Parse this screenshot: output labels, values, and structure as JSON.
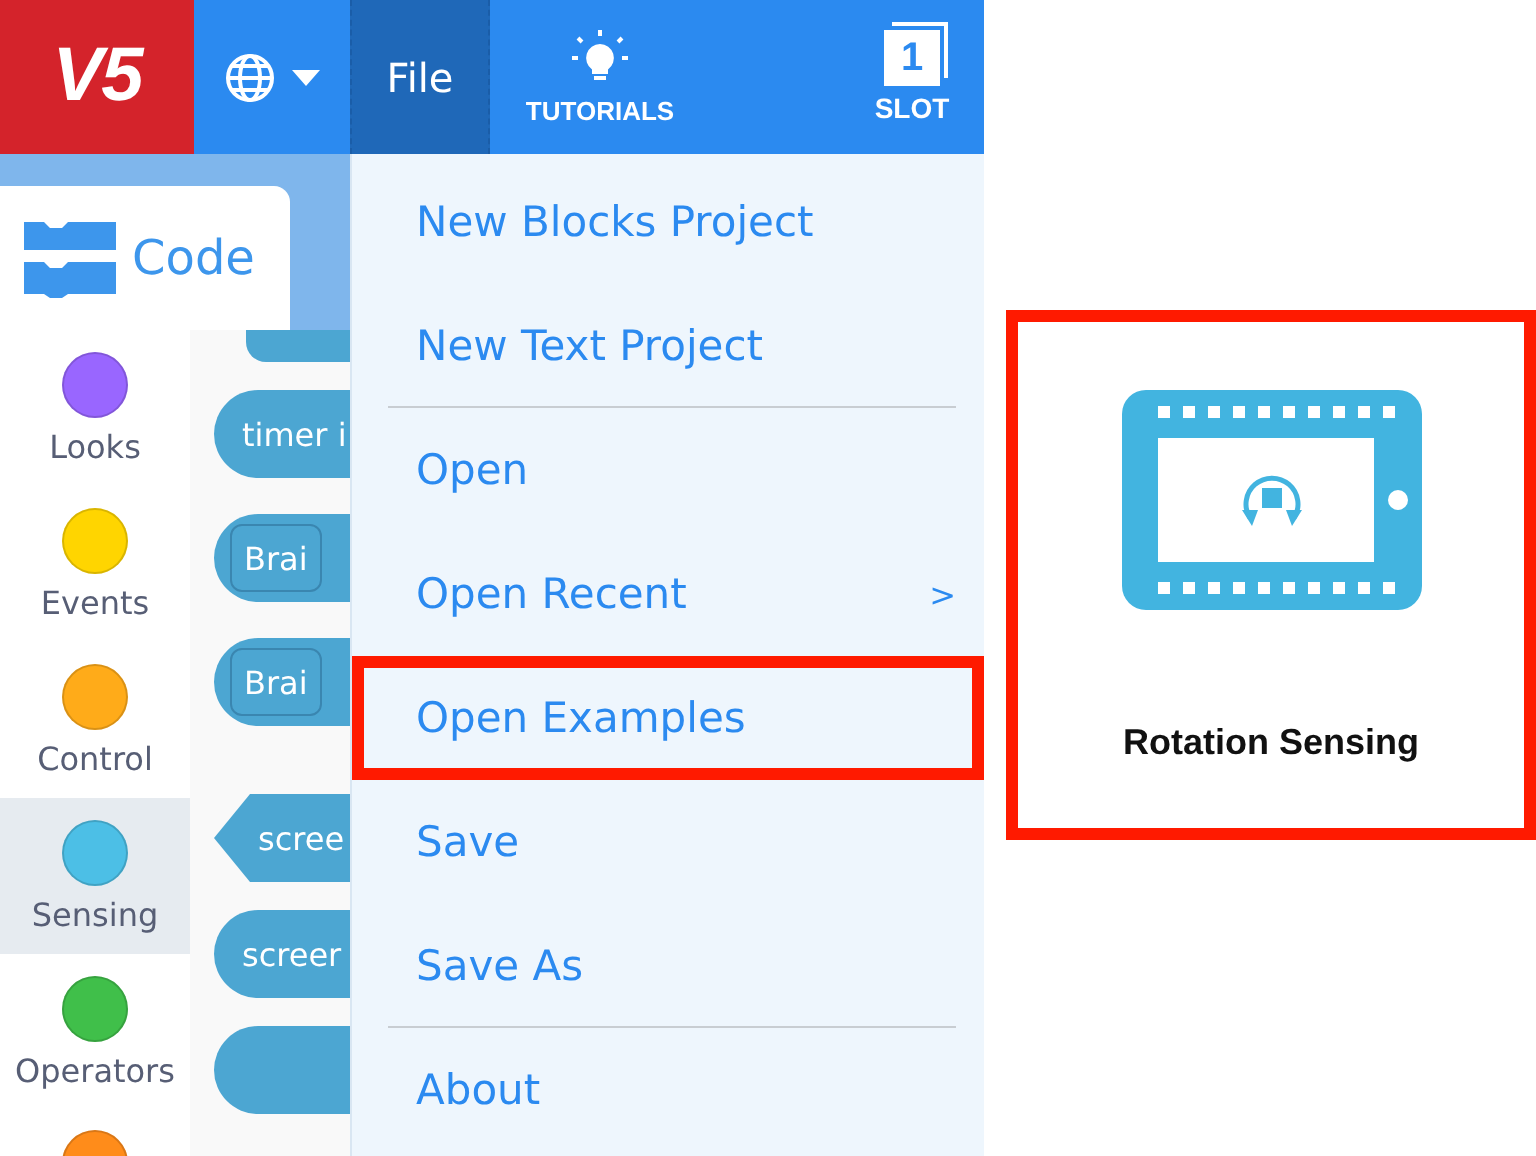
{
  "topbar": {
    "logo": "V5",
    "menus": [
      {
        "kind": "language",
        "selected": false
      },
      {
        "kind": "text",
        "label": "File",
        "selected": true
      },
      {
        "kind": "tutorials",
        "label": "TUTORIALS",
        "selected": false
      }
    ],
    "slot": {
      "number": "1",
      "label": "SLOT"
    }
  },
  "code_tab": {
    "label": "Code"
  },
  "categories": [
    {
      "label": "Looks",
      "color": "#9966ff",
      "selected": false
    },
    {
      "label": "Events",
      "color": "#ffd500",
      "selected": false
    },
    {
      "label": "Control",
      "color": "#ffab19",
      "selected": false
    },
    {
      "label": "Sensing",
      "color": "#4cbfe6",
      "selected": true
    },
    {
      "label": "Operators",
      "color": "#40bf4a",
      "selected": false
    },
    {
      "color": "#ff8c1a",
      "selected": false
    }
  ],
  "blocks": [
    {
      "kind": "top"
    },
    {
      "kind": "reporter",
      "text": "timer i"
    },
    {
      "kind": "dropdown",
      "text": "Brai"
    },
    {
      "kind": "dropdown",
      "text": "Brai"
    },
    {
      "kind": "boolean",
      "text": "scree"
    },
    {
      "kind": "reporter",
      "text": "screer"
    },
    {
      "kind": "reporter"
    }
  ],
  "file_menu": [
    {
      "label": "New Blocks Project",
      "highlighted": false
    },
    {
      "label": "New Text Project",
      "highlighted": false,
      "divider_after": true
    },
    {
      "label": "Open",
      "highlighted": false
    },
    {
      "label": "Open Recent",
      "submenu": ">",
      "highlighted": false
    },
    {
      "label": "Open Examples",
      "highlighted": true
    },
    {
      "label": "Save",
      "highlighted": false
    },
    {
      "label": "Save As",
      "highlighted": false,
      "divider_after": true
    },
    {
      "label": "About",
      "highlighted": false
    }
  ],
  "example": {
    "title": "Rotation Sensing",
    "highlighted": true
  }
}
